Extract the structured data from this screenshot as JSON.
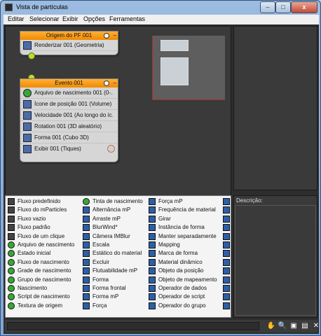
{
  "window": {
    "title": "Vista de partículas",
    "buttons": {
      "minimize": "–",
      "maximize": "□",
      "close": "x"
    }
  },
  "menu": [
    "Editar",
    "Selecionar",
    "Exibir",
    "Opções",
    "Ferramentas"
  ],
  "nodes": {
    "origin": {
      "title": "Origem do PF 001",
      "ops": [
        "Renderizar 001 (Geometria)"
      ]
    },
    "event": {
      "title": "Evento 001",
      "ops": [
        "Arquivo de nascimento 001 (0-...",
        "Ícone de posição 001 (Volume)",
        "Velocidade 001 (Ao longo do íc...",
        "Rotation 001 (3D aleatório)",
        "Forma 001 (Cubo 3D)",
        "Exibir 001 (Tiques)"
      ]
    }
  },
  "depot": {
    "col1": [
      "Fluxo predefinido",
      "Fluxo do mParticles",
      "Fluxo vazio",
      "Fluxo padrão",
      "Fluxo de um clique",
      "Arquivo de nascimento",
      "Estado inicial",
      "Fluxo de nascimento",
      "Grade de nascimento",
      "Grupo de nascimento",
      "Nascimento",
      "Script de nascimento",
      "Textura de origem"
    ],
    "col2": [
      "Tinta de nascimento",
      "Alternância mP",
      "Arraste mP",
      "BlurWind*",
      "Câmera IMBlur",
      "Escala",
      "Estático do material",
      "Excluir",
      "Flutuabilidade mP",
      "Forma",
      "Forma frontal",
      "Forma mP",
      "Força"
    ],
    "col3": [
      "Força mP",
      "Frequência de material",
      "Girar",
      "Instância de forma",
      "Manter separadamente",
      "Mapping",
      "Marca de forma",
      "Material dinâmico",
      "Objeto da posição",
      "Objeto de mapeamento",
      "Operador de dados",
      "Operador de script",
      "Operador do grupo"
    ]
  },
  "description": {
    "label": "Descrição:"
  },
  "toolbar_icons": [
    "hand-icon",
    "zoom-icon",
    "zoom-region-icon",
    "zoom-extents-icon",
    "no-zoom-icon"
  ]
}
